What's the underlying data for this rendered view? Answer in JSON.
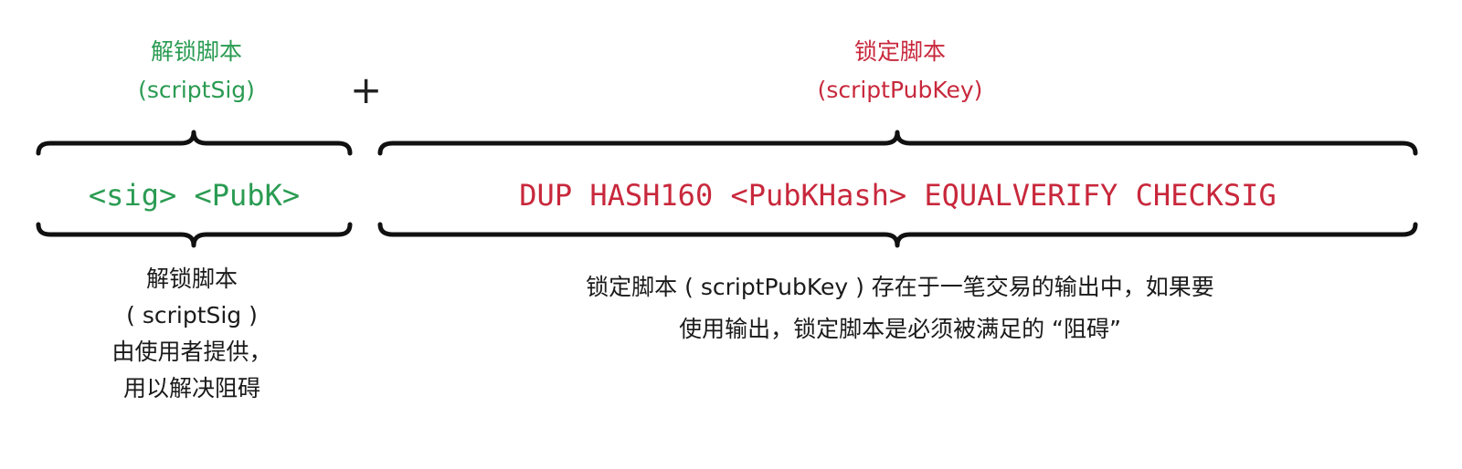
{
  "unlocking": {
    "title": "解锁脚本",
    "subtitle": "(scriptSig)",
    "script": "<sig> <PubK>",
    "description": [
      "解锁脚本",
      "( scriptSig )",
      "由使用者提供，",
      "用以解决阻碍"
    ]
  },
  "plus": "+",
  "locking": {
    "title": "锁定脚本",
    "subtitle": "(scriptPubKey)",
    "script": "DUP HASH160 <PubKHash> EQUALVERIFY CHECKSIG",
    "description": [
      "锁定脚本 ( scriptPubKey ) 存在于一笔交易的输出中，如果要",
      "使用输出，锁定脚本是必须被满足的 “阻碍”"
    ]
  },
  "colors": {
    "unlocking": "#2a9b52",
    "locking": "#c8283c",
    "text": "#1a1a1a"
  }
}
